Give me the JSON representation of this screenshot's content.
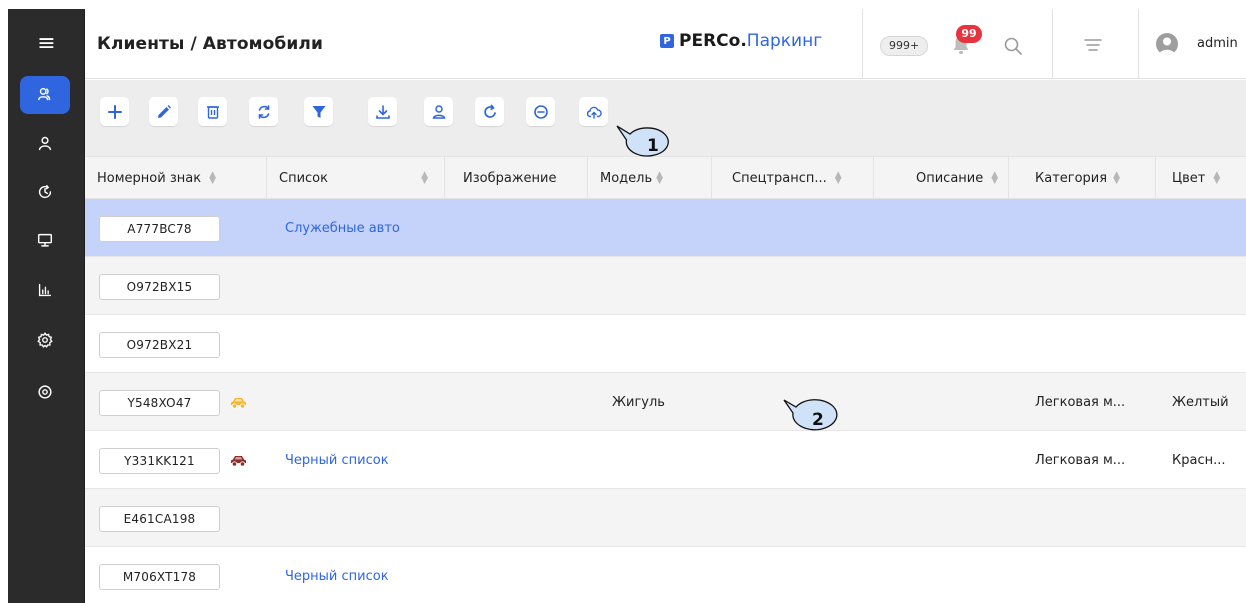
{
  "header": {
    "page_title": "Клиенты / Автомобили",
    "brand_mark": "P",
    "brand_name": "PERCo.",
    "brand_product": "Паркинг",
    "count_badge": "999+",
    "notification_count": "99",
    "username": "admin"
  },
  "sidebar": {
    "items": [
      {
        "icon": "users-icon",
        "active": true
      },
      {
        "icon": "person-icon",
        "active": false
      },
      {
        "icon": "history-icon",
        "active": false
      },
      {
        "icon": "monitor-icon",
        "active": false
      },
      {
        "icon": "reports-icon",
        "active": false
      },
      {
        "icon": "settings-icon",
        "active": false
      },
      {
        "icon": "eye-icon",
        "active": false
      }
    ]
  },
  "toolbar": {
    "buttons": [
      "add-icon",
      "edit-icon",
      "delete-icon",
      "refresh-icon",
      "filter-icon",
      "download-icon",
      "user-icon",
      "reload-icon",
      "minus-circle-icon",
      "cloud-upload-icon"
    ]
  },
  "table": {
    "columns": [
      "Номерной знак",
      "Список",
      "Изображение",
      "Модель",
      "Спецтрансп...",
      "Описание",
      "Категория",
      "Цвет"
    ],
    "rows": [
      {
        "plate": "A777BC78",
        "list": "Служебные авто",
        "model": "",
        "category": "",
        "color": "",
        "car": ""
      },
      {
        "plate": "O972BX15",
        "list": "",
        "model": "",
        "category": "",
        "color": "",
        "car": ""
      },
      {
        "plate": "O972BX21",
        "list": "",
        "model": "",
        "category": "",
        "color": "",
        "car": ""
      },
      {
        "plate": "Y548XO47",
        "list": "",
        "model": "Жигуль",
        "category": "Легковая м...",
        "color": "Желтый",
        "car": "#f2b531"
      },
      {
        "plate": "Y331KK121",
        "list": "Черный список",
        "model": "",
        "category": "Легковая м...",
        "color": "Красн...",
        "car": "#8e2b2b"
      },
      {
        "plate": "E461CA198",
        "list": "",
        "model": "",
        "category": "",
        "color": "",
        "car": ""
      },
      {
        "plate": "M706XT178",
        "list": "Черный список",
        "model": "",
        "category": "",
        "color": "",
        "car": ""
      }
    ]
  },
  "callouts": [
    "1",
    "2"
  ],
  "colors": {
    "accent": "#2f66e0",
    "sidebar_bg": "#2b2b2b",
    "selected_row": "#c5d3fb",
    "badge_red": "#e8323c",
    "callout_fill": "#cfe2f8"
  }
}
